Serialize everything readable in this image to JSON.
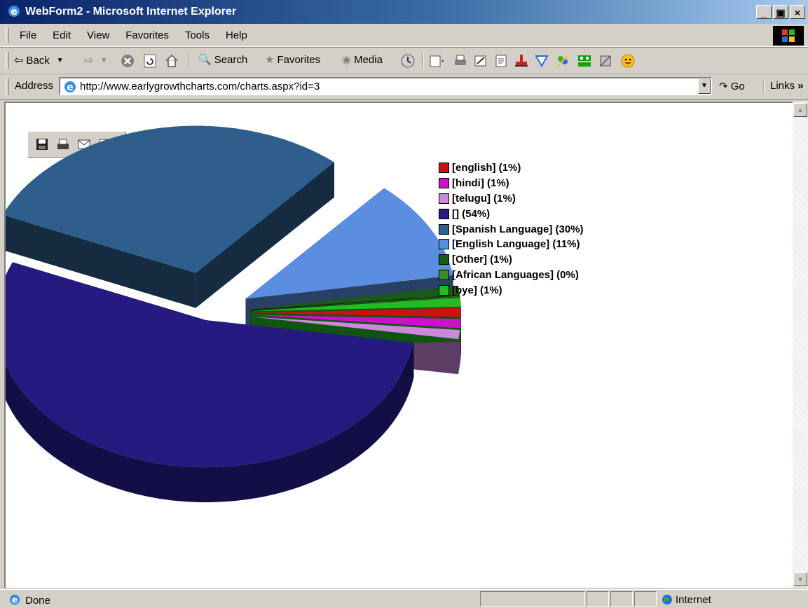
{
  "window": {
    "title": "WebForm2 - Microsoft Internet Explorer"
  },
  "menu": {
    "items": [
      "File",
      "Edit",
      "View",
      "Favorites",
      "Tools",
      "Help"
    ]
  },
  "toolbar": {
    "back": "Back",
    "search": "Search",
    "favorites": "Favorites",
    "media": "Media"
  },
  "address": {
    "label": "Address",
    "url": "http://www.earlygrowthcharts.com/charts.aspx?id=3",
    "go": "Go",
    "links": "Links"
  },
  "status": {
    "text": "Done",
    "zone": "Internet"
  },
  "chart_data": {
    "type": "pie",
    "style": "3d-exploded",
    "title": "",
    "legend_position": "top-right",
    "slices": [
      {
        "label": "[english] (1%)",
        "value": 1,
        "color": "#cc1111"
      },
      {
        "label": "[hindi] (1%)",
        "value": 1,
        "color": "#cc11cc"
      },
      {
        "label": "[telugu] (1%)",
        "value": 1,
        "color": "#cc88dd"
      },
      {
        "label": "[] (54%)",
        "value": 54,
        "color": "#241a80"
      },
      {
        "label": "[Spanish Language] (30%)",
        "value": 30,
        "color": "#2e5f8c"
      },
      {
        "label": "[English Language] (11%)",
        "value": 11,
        "color": "#5b8ee0"
      },
      {
        "label": "[Other] (1%)",
        "value": 1,
        "color": "#1a5a1a"
      },
      {
        "label": "[African Languages] (0%)",
        "value": 0,
        "color": "#3a8a2a"
      },
      {
        "label": "[bye] (1%)",
        "value": 1,
        "color": "#22bb22"
      }
    ]
  }
}
